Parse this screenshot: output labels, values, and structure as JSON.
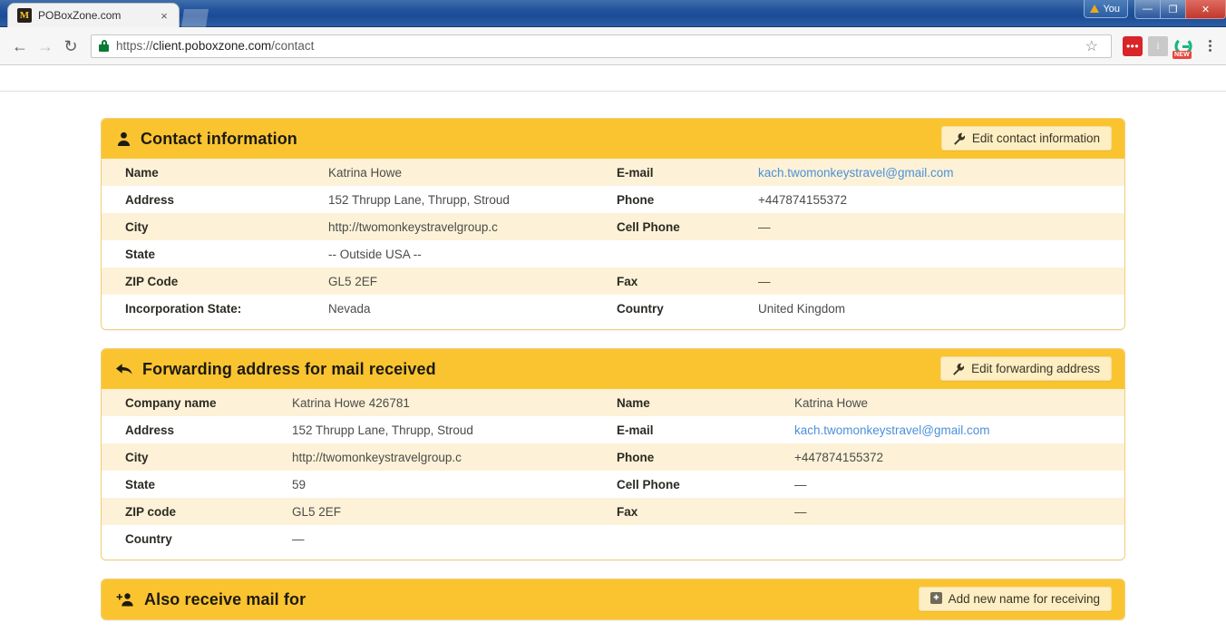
{
  "browser": {
    "tab": {
      "title": "POBoxZone.com",
      "favicon_glyph": "M",
      "close_label": "×"
    },
    "nav": {
      "back": "←",
      "forward": "→",
      "reload": "↻"
    },
    "address": {
      "scheme": "https://",
      "host": "client.poboxzone.com",
      "path": "/contact"
    },
    "profile_label": "You",
    "window": {
      "minimize": "—",
      "maximize": "❐",
      "close": "✕"
    },
    "extensions": [
      {
        "name": "pocket-extension",
        "glyph": "•••"
      },
      {
        "name": "info-extension",
        "glyph": "i"
      },
      {
        "name": "grammarly-extension",
        "badge": "NEW"
      }
    ]
  },
  "panels": [
    {
      "id": "contact-information",
      "icon": "person-icon",
      "title": "Contact information",
      "action": {
        "label": "Edit contact information",
        "icon": "wrench-icon"
      },
      "left_rows": [
        {
          "label": "Name",
          "value": "Katrina Howe"
        },
        {
          "label": "Address",
          "value": "152 Thrupp Lane, Thrupp, Stroud"
        },
        {
          "label": "City",
          "value": "http://twomonkeystravelgroup.c"
        },
        {
          "label": "State",
          "value": "-- Outside USA --"
        },
        {
          "label": "ZIP Code",
          "value": "GL5 2EF"
        },
        {
          "label": "Incorporation State:",
          "value": "Nevada"
        }
      ],
      "right_rows": [
        {
          "label": "E-mail",
          "value": "kach.twomonkeystravel@gmail.com",
          "link": true
        },
        {
          "label": "Phone",
          "value": "+447874155372"
        },
        {
          "label": "Cell Phone",
          "value": "—"
        },
        {
          "label": "",
          "value": ""
        },
        {
          "label": "Fax",
          "value": "—"
        },
        {
          "label": "Country",
          "value": "United Kingdom"
        }
      ]
    },
    {
      "id": "forwarding-address",
      "icon": "reply-arrow-icon",
      "title": "Forwarding address for mail received",
      "action": {
        "label": "Edit forwarding address",
        "icon": "wrench-icon"
      },
      "left_rows": [
        {
          "label": "Company name",
          "value": "Katrina Howe 426781"
        },
        {
          "label": "Address",
          "value": "152 Thrupp Lane, Thrupp, Stroud"
        },
        {
          "label": "City",
          "value": "http://twomonkeystravelgroup.c"
        },
        {
          "label": "State",
          "value": "59"
        },
        {
          "label": "ZIP code",
          "value": "GL5 2EF"
        },
        {
          "label": "Country",
          "value": "—"
        }
      ],
      "right_rows": [
        {
          "label": "Name",
          "value": "Katrina Howe"
        },
        {
          "label": "E-mail",
          "value": "kach.twomonkeystravel@gmail.com",
          "link": true
        },
        {
          "label": "Phone",
          "value": "+447874155372"
        },
        {
          "label": "Cell Phone",
          "value": "—"
        },
        {
          "label": "Fax",
          "value": "—"
        },
        {
          "label": "",
          "value": ""
        }
      ]
    },
    {
      "id": "also-receive-mail-for",
      "icon": "user-plus-icon",
      "title": "Also receive mail for",
      "action": {
        "label": "Add new name for receiving",
        "icon": "plus-square-icon"
      },
      "left_rows": [],
      "right_rows": []
    }
  ],
  "colors": {
    "header_amber": "#fac431",
    "row_cream": "#fdf2d7",
    "panel_border": "#f0cf7a",
    "button_face": "#fdeec3",
    "link_blue": "#4c90d9",
    "titlebar_blue": "#22539c"
  }
}
